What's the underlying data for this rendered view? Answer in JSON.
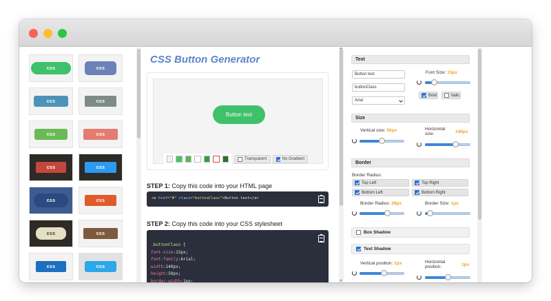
{
  "thumbnails": [
    {
      "label": "css",
      "bg": "#3fc06a"
    },
    {
      "label": "css",
      "bg": "#6a82b8"
    },
    {
      "label": "css",
      "bg": "#4d93b7"
    },
    {
      "label": "css",
      "bg": "#7e8c89"
    },
    {
      "label": "css",
      "bg": "#6bba58"
    },
    {
      "label": "css",
      "bg": "#e47c72"
    },
    {
      "label": "css",
      "bg": "#c4473d"
    },
    {
      "label": "css",
      "bg": "#2b9af0"
    },
    {
      "label": "css",
      "bg": "#2b4a7f"
    },
    {
      "label": "css",
      "bg": "#e05a2b"
    },
    {
      "label": "css",
      "bg": "#e5dfc4"
    },
    {
      "label": "css",
      "bg": "#7d5a3c"
    },
    {
      "label": "css",
      "bg": "#1d6fbf"
    },
    {
      "label": "css",
      "bg": "#2ca7e8"
    }
  ],
  "generator": {
    "title": "CSS Button Generator",
    "preview_button": "Button text",
    "swatches": [
      "#f2f2f2",
      "#45c46c",
      "#5ab84e",
      "#ffffff",
      "#2ea040",
      "#ffffff",
      "#2f6e2f"
    ],
    "transparent_label": "Transparent",
    "no_gradient_label": "No Gradient",
    "step1_bold": "STEP 1:",
    "step1_text": " Copy this code into your HTML page",
    "step2_bold": "STEP 2:",
    "step2_text": " Copy this code into your CSS stylesheet",
    "html_code": {
      "open": "<a ",
      "attr1": "href=",
      "val1": "\"#\"",
      "attr2": " class=",
      "val2": "\"buttonClass\"",
      "inner": ">Button text</a>"
    },
    "css_lines": [
      {
        "prop": ".buttonClass",
        "val": " {"
      },
      {
        "prop": "  font-size",
        "val": ":15px;"
      },
      {
        "prop": "  font-family",
        "val": ":Arial;"
      },
      {
        "prop": "  width",
        "val": ":140px;"
      },
      {
        "prop": "  height",
        "val": ":50px;"
      },
      {
        "prop": "  border-width",
        "val": ":1px;"
      }
    ]
  },
  "settings": {
    "text_header": "Text",
    "text_value": "Button text",
    "class_value": "buttonClass",
    "font_value": "Arial",
    "font_size_label": "Font Size:",
    "font_size_value": "15px",
    "bold_label": "Bold",
    "italic_label": "Italic",
    "size_header": "Size",
    "vertical_size_label": "Vertical size:",
    "vertical_size_value": "50px",
    "horizontal_size_label": "Horizontal size:",
    "horizontal_size_value": "140px",
    "border_header": "Border",
    "border_radius_label": "Border Radius:",
    "top_left": "Top Left",
    "top_right": "Top Right",
    "bottom_left": "Bottom Left",
    "bottom_right": "Bottom Right",
    "border_radius_slider_label": "Border Radius:",
    "border_radius_value": "28px",
    "border_size_label": "Border Size:",
    "border_size_value": "1px",
    "box_shadow_label": "Box Shadow",
    "text_shadow_label": "Text Shadow",
    "vertical_position_label": "Vertical position:",
    "vertical_position_value": "1px",
    "horizontal_position_label": "Horizontal position:",
    "horizontal_position_value": "1px",
    "slider_levels": {
      "font_size": 0.15,
      "vertical_size": 0.5,
      "horizontal_size": 0.7,
      "border_radius": 0.65,
      "border_size": 0.05,
      "vertical_position": 0.55,
      "horizontal_position": 0.5
    }
  },
  "colors": {
    "accent": "#5d86c9",
    "value_orange": "#f0a020",
    "code_bg": "#2b2e3b",
    "preview_green": "#3fc06a"
  }
}
